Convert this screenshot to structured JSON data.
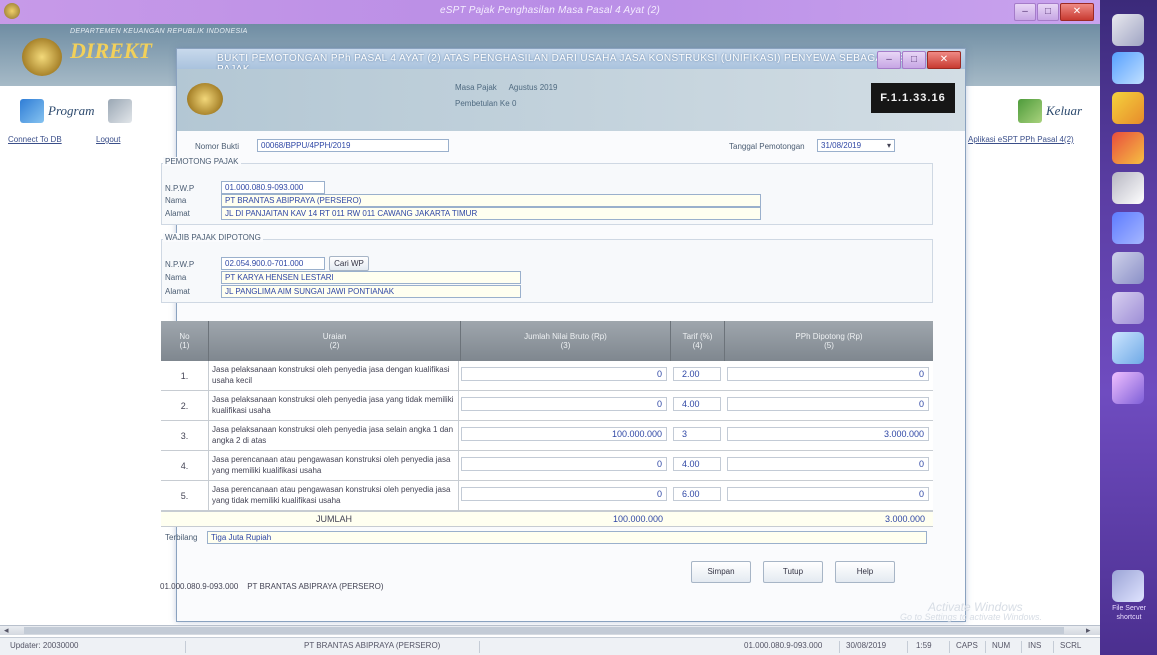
{
  "app": {
    "title": "eSPT Pajak Penghasilan Masa Pasal 4 Ayat (2)",
    "department": "DEPARTEMEN KEUANGAN REPUBLIK INDONESIA",
    "logo_text": "DIREKT",
    "window_buttons": {
      "min": "–",
      "max": "□",
      "close": "✕"
    }
  },
  "toolbar": {
    "program_label": "Program",
    "exit_label": "Keluar",
    "connect_label": "Connect To DB",
    "logout_label": "Logout",
    "status_label": "Aplikasi eSPT PPh Pasal 4(2)"
  },
  "dialog": {
    "title": "BUKTI PEMOTONGAN PPh PASAL 4 AYAT (2) ATAS PENGHASILAN DARI USAHA JASA KONSTRUKSI (UNIFIKASI) PENYEWA SEBAGAI PEMOTONG PAJAK",
    "masa_pajak_label": "Masa Pajak",
    "masa_pajak_value": "Agustus 2019",
    "pembetulan_label": "Pembetulan Ke",
    "pembetulan_value": "0",
    "form_code": "F.1.1.33.16",
    "nomor_bukti_label": "Nomor Bukti",
    "nomor_bukti_value": "00068/BPPU/4PPH/2019",
    "tanggal_label": "Tanggal Pemotongan",
    "tanggal_value": "31/08/2019",
    "pemotong": {
      "section_title": "PEMOTONG PAJAK",
      "npwp_label": "N.P.W.P",
      "npwp_value": "01.000.080.9-093.000",
      "nama_label": "Nama",
      "nama_value": "PT BRANTAS ABIPRAYA (PERSERO)",
      "alamat_label": "Alamat",
      "alamat_value": "JL DI PANJAITAN KAV 14 RT 011 RW 011 CAWANG JAKARTA TIMUR"
    },
    "wajib_pajak": {
      "section_title": "WAJIB PAJAK DIPOTONG",
      "npwp_label": "N.P.W.P",
      "npwp_value": "02.054.900.0-701.000",
      "cari_label": "Cari WP",
      "nama_label": "Nama",
      "nama_value": "PT KARYA HENSEN LESTARI",
      "alamat_label": "Alamat",
      "alamat_value": "JL PANGLIMA AIM SUNGAI JAWI PONTIANAK"
    },
    "table": {
      "headers": [
        "No",
        "Uraian",
        "Jumlah Nilai Bruto (Rp)",
        "Tarif (%)",
        "PPh Dipotong (Rp)"
      ],
      "header_sub": [
        "(1)",
        "(2)",
        "(3)",
        "(4)",
        "(5)"
      ],
      "rows": [
        {
          "no": "1.",
          "uraian": "Jasa pelaksanaan konstruksi oleh penyedia jasa dengan kualifikasi usaha kecil",
          "dpp": "0",
          "tarif": "2.00",
          "pph": "0"
        },
        {
          "no": "2.",
          "uraian": "Jasa pelaksanaan konstruksi oleh penyedia jasa yang tidak memiliki kualifikasi usaha",
          "dpp": "0",
          "tarif": "4.00",
          "pph": "0"
        },
        {
          "no": "3.",
          "uraian": "Jasa pelaksanaan konstruksi oleh penyedia jasa selain angka 1 dan angka 2 di atas",
          "dpp": "100.000.000",
          "tarif": "3",
          "pph": "3.000.000"
        },
        {
          "no": "4.",
          "uraian": "Jasa perencanaan atau pengawasan konstruksi oleh penyedia jasa yang memiliki kualifikasi usaha",
          "dpp": "0",
          "tarif": "4.00",
          "pph": "0"
        },
        {
          "no": "5.",
          "uraian": "Jasa perencanaan atau pengawasan konstruksi oleh penyedia jasa yang tidak memiliki kualifikasi usaha",
          "dpp": "0",
          "tarif": "6.00",
          "pph": "0"
        }
      ],
      "total_label": "JUMLAH",
      "total_dpp": "100.000.000",
      "total_pph": "3.000.000"
    },
    "terbilang_label": "Terbilang",
    "terbilang_value": "Tiga Juta Rupiah",
    "buttons": {
      "save": "Simpan",
      "close": "Tutup",
      "help": "Help"
    },
    "footer_npwp": "01.000.080.9-093.000",
    "footer_name": "PT BRANTAS ABIPRAYA (PERSERO)"
  },
  "watermark": {
    "line1": "Activate Windows",
    "line2": "Go to Settings to activate Windows."
  },
  "side_text": "File Server shortcut",
  "status_bar": {
    "updater": "Updater: 20030000",
    "company": "PT BRANTAS ABIPRAYA (PERSERO)",
    "npwp": "01.000.080.9-093.000",
    "date": "30/08/2019",
    "time": "1:59",
    "caps": "CAPS",
    "num": "NUM",
    "ins": "INS",
    "scrl": "SCRL"
  },
  "colors": {
    "accent_purple": "#6f4cc0",
    "form_code_bg": "#161616",
    "input_text": "#2f47a5"
  }
}
